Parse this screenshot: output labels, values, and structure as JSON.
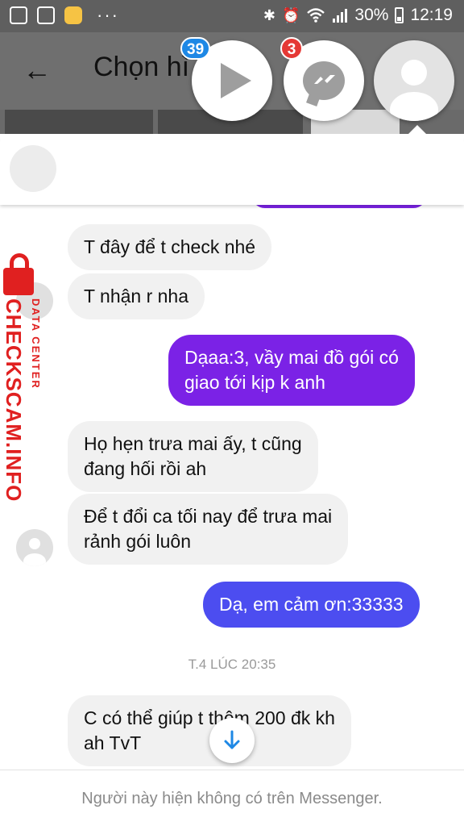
{
  "status_bar": {
    "battery": "30%",
    "time": "12:19",
    "dots": "···",
    "icons": [
      "image-icon",
      "close-box-icon",
      "app-icon",
      "bluetooth-icon",
      "alarm-icon",
      "wifi-icon",
      "signal-icon",
      "battery-icon"
    ]
  },
  "background_app": {
    "title": "Chọn hì"
  },
  "chat_heads": [
    {
      "name": "video",
      "badge": "39",
      "badge_color": "#1e88e5"
    },
    {
      "name": "messenger",
      "badge": "3",
      "badge_color": "#e53935"
    },
    {
      "name": "contact"
    }
  ],
  "conversation": {
    "messages": [
      {
        "direction": "in",
        "text": "T đây để t check nhé"
      },
      {
        "direction": "in",
        "text": "T nhận r nha"
      },
      {
        "direction": "out",
        "lines": [
          "Dạaa:3, vầy mai đồ gói có",
          "giao tới kịp k anh"
        ]
      },
      {
        "direction": "in",
        "lines": [
          "Họ hẹn trưa mai ấy, t cũng",
          "đang hối rồi ah"
        ]
      },
      {
        "direction": "in",
        "lines": [
          "Để t đổi ca tối nay để trưa mai",
          "rảnh gói luôn"
        ]
      },
      {
        "direction": "out",
        "text": "Dạ, em cảm ơn:33333"
      },
      {
        "direction": "in",
        "lines": [
          "C có thể giúp t thêm 200 đk kh",
          "ah TvT"
        ]
      }
    ],
    "timestamp": "T.4 LÚC 20:35"
  },
  "footer": {
    "text": "Người này hiện không có trên Messenger."
  },
  "watermark": {
    "main": "CHECKSCAM.INFO",
    "sub": "DATA CENTER"
  },
  "colors": {
    "outgoing_purple": "#7b22e6",
    "outgoing_blue": "#4c4df0",
    "incoming": "#f1f1f1",
    "watermark": "#e02020"
  }
}
